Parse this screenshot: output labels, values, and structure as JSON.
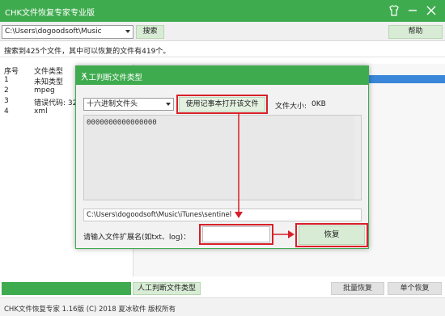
{
  "app": {
    "title": "CHK文件恢复专家专业版"
  },
  "toolbar": {
    "path_value": "C:\\Users\\dogoodsoft\\Music",
    "search_label": "搜索",
    "help_label": "帮助"
  },
  "status": {
    "text": "搜索到425个文件，其中可以恢复的文件有419个。"
  },
  "filelist": {
    "headers": [
      "序号",
      "文件类型"
    ],
    "rows": [
      {
        "id": "1",
        "type": "未知类型"
      },
      {
        "id": "2",
        "type": "mpeg"
      },
      {
        "id": "3",
        "type": "错误代码: 32"
      },
      {
        "id": "4",
        "type": "xml"
      }
    ]
  },
  "dialog": {
    "title": "人工判断文件类型",
    "header_select": "十六进制文件头",
    "open_notepad_label": "使用记事本打开该文件",
    "size_label": "文件大小:",
    "size_value": "0KB",
    "hex_content": "0000000000000000",
    "file_path": "C:\\Users\\dogoodsoft\\Music\\iTunes\\sentinel",
    "ext_prompt": "请输入文件扩展名(如txt、log)：",
    "ext_value": "",
    "recover_label": "恢复"
  },
  "bottom": {
    "manual_label": "人工判断文件类型",
    "batch_label": "批量恢复",
    "single_label": "单个恢复"
  },
  "footer": {
    "text": "CHK文件恢复专家  1.16版  (C) 2018 夏冰软件 版权所有"
  },
  "colors": {
    "accent_green": "#3fab4f",
    "highlight_red": "#d8202a",
    "selection_blue": "#3a86d8"
  }
}
